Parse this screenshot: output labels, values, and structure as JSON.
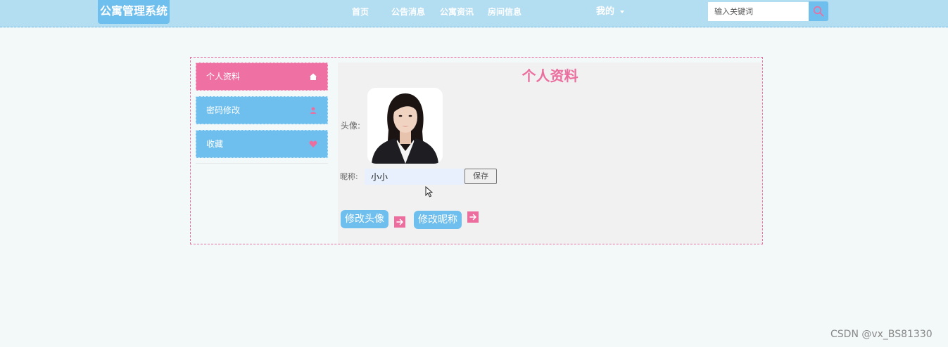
{
  "header": {
    "logo": "公寓管理系统",
    "nav": [
      {
        "label": "首页"
      },
      {
        "label": "公告消息"
      },
      {
        "label": "公寓资讯"
      },
      {
        "label": "房间信息"
      }
    ],
    "mine_label": "我的",
    "search": {
      "placeholder": "输入关键词",
      "value": ""
    }
  },
  "sidebar": {
    "items": [
      {
        "label": "个人资料",
        "icon": "home-icon"
      },
      {
        "label": "密码修改",
        "icon": "user-icon"
      },
      {
        "label": "收藏",
        "icon": "heart-icon"
      }
    ]
  },
  "profile": {
    "title": "个人资料",
    "avatar_label": "头像:",
    "nickname_label": "昵称:",
    "nickname_value": "小小",
    "save_label": "保存",
    "change_avatar_label": "修改头像",
    "change_nickname_label": "修改昵称"
  },
  "watermark": "CSDN @vx_BS81330",
  "colors": {
    "header_bg": "#b3ddf1",
    "accent_blue": "#6fbfee",
    "accent_pink": "#ec6e9f",
    "page_bg": "#f3f8f9"
  }
}
